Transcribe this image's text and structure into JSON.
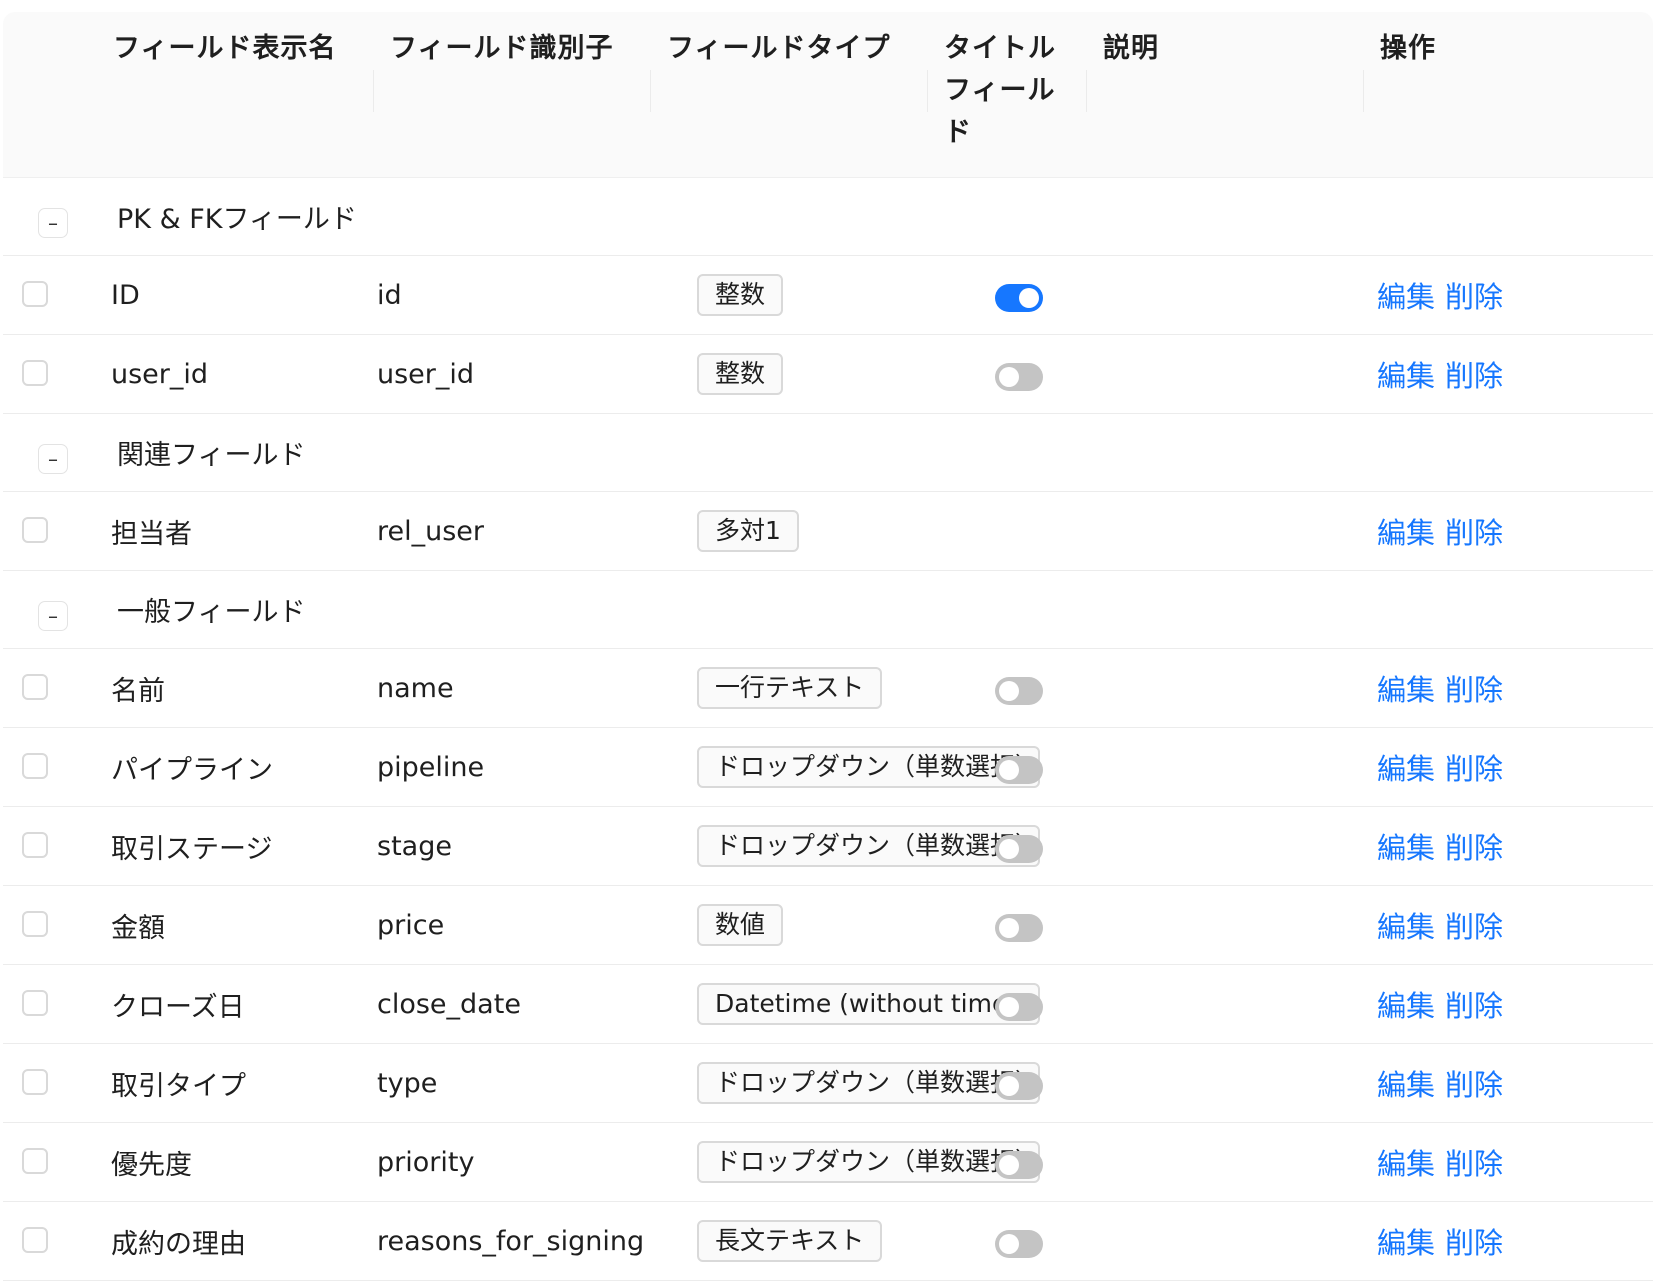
{
  "headers": {
    "display_name": "フィールド表示名",
    "identifier": "フィールド識別子",
    "type": "フィールドタイプ",
    "title_field_line1": "タイトル",
    "title_field_line2": "フィール",
    "title_field_line3": "ド",
    "description": "説明",
    "actions": "操作"
  },
  "actions": {
    "edit": "編集",
    "delete": "削除"
  },
  "groups": [
    {
      "label": "PK & FKフィールド",
      "rows": [
        {
          "name": "ID",
          "identifier": "id",
          "type": "整数",
          "title_field": true
        },
        {
          "name": "user_id",
          "identifier": "user_id",
          "type": "整数",
          "title_field": false
        }
      ]
    },
    {
      "label": "関連フィールド",
      "rows": [
        {
          "name": "担当者",
          "identifier": "rel_user",
          "type": "多対1",
          "title_field": null
        }
      ]
    },
    {
      "label": "一般フィールド",
      "rows": [
        {
          "name": "名前",
          "identifier": "name",
          "type": "一行テキスト",
          "title_field": false
        },
        {
          "name": "パイプライン",
          "identifier": "pipeline",
          "type": "ドロップダウン（単数選択）",
          "title_field": false
        },
        {
          "name": "取引ステージ",
          "identifier": "stage",
          "type": "ドロップダウン（単数選択）",
          "title_field": false
        },
        {
          "name": "金額",
          "identifier": "price",
          "type": "数値",
          "title_field": false
        },
        {
          "name": "クローズ日",
          "identifier": "close_date",
          "type": "Datetime (without time zone)",
          "title_field": false
        },
        {
          "name": "取引タイプ",
          "identifier": "type",
          "type": "ドロップダウン（単数選択）",
          "title_field": false
        },
        {
          "name": "優先度",
          "identifier": "priority",
          "type": "ドロップダウン（単数選択）",
          "title_field": false
        },
        {
          "name": "成約の理由",
          "identifier": "reasons_for_signing",
          "type": "長文テキスト",
          "title_field": false
        }
      ]
    }
  ],
  "colors": {
    "accent": "#1677ff",
    "switch_off": "#c4c4c4"
  }
}
